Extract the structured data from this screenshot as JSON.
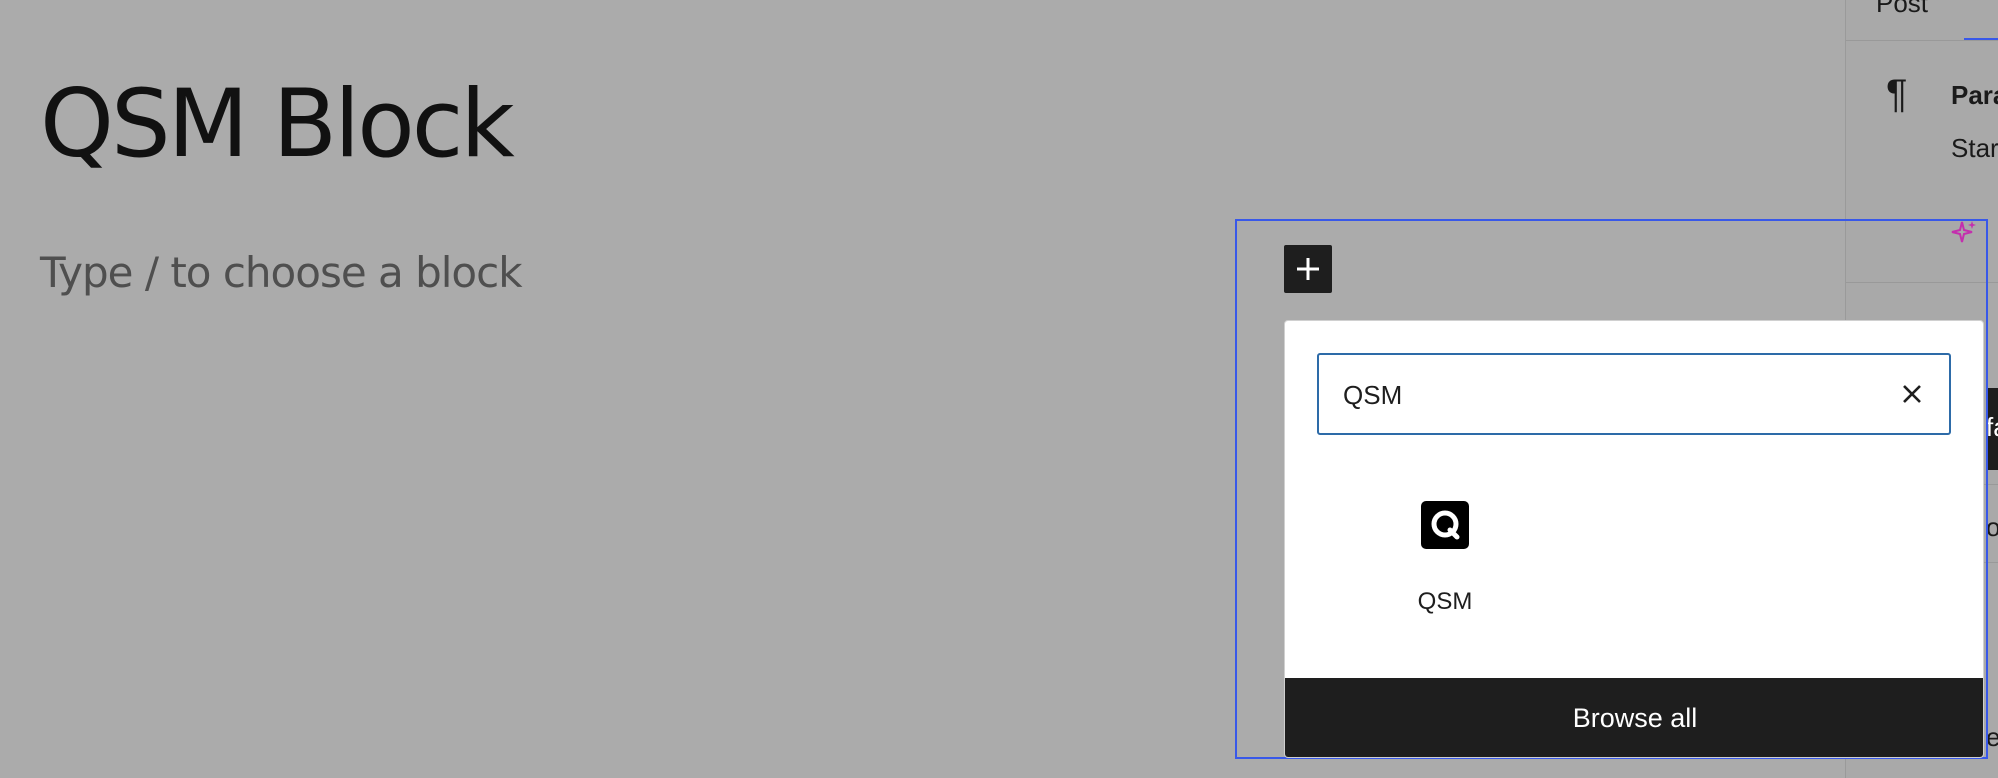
{
  "editor": {
    "post_title": "QSM Block",
    "block_placeholder": "Type / to choose a block"
  },
  "sidebar": {
    "tab_label": "Post",
    "block_name": "Para",
    "block_description": "Star bloc",
    "fragment_1": "fa",
    "fragment_2": "ot",
    "fragment_3": "ek"
  },
  "inserter": {
    "toggle_icon": "plus-icon",
    "search": {
      "value": "QSM",
      "clear_icon": "close-icon"
    },
    "results": [
      {
        "label": "QSM",
        "icon": "qsm-logo-icon"
      }
    ],
    "browse_all_label": "Browse all"
  },
  "colors": {
    "focus": "#3858e9",
    "search_border": "#2d6ba8",
    "dark": "#1e1e1e",
    "sparkle": "#c42fae"
  }
}
